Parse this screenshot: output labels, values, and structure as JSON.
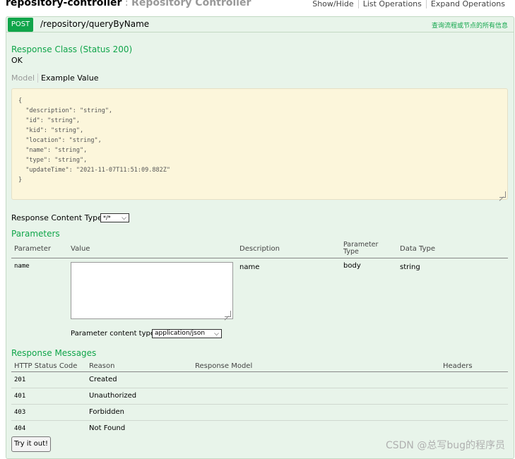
{
  "header": {
    "controller_name": "repository-controller",
    "separator": " : ",
    "controller_desc": "Repository Controller",
    "links": [
      "Show/Hide",
      "List Operations",
      "Expand Operations"
    ]
  },
  "operation": {
    "method": "POST",
    "path": "/repository/queryByName",
    "summary": "查询流程或节点的所有信息"
  },
  "response_class": {
    "title": "Response Class (Status 200)",
    "status": "OK",
    "tabs": {
      "model": "Model",
      "example": "Example Value"
    },
    "example_lines": [
      "{",
      "  \"description\": \"string\",",
      "  \"id\": \"string\",",
      "  \"kid\": \"string\",",
      "  \"location\": \"string\",",
      "  \"name\": \"string\",",
      "  \"type\": \"string\",",
      "  \"updateTime\": \"2021-11-07T11:51:09.882Z\"",
      "}"
    ]
  },
  "response_content_type": {
    "label": "Response Content Type",
    "selected": "*/*"
  },
  "parameters": {
    "title": "Parameters",
    "headers": {
      "parameter": "Parameter",
      "value": "Value",
      "description": "Description",
      "parameter_type_1": "Parameter",
      "parameter_type_2": "Type",
      "data_type": "Data Type"
    },
    "rows": [
      {
        "name": "name",
        "value": "",
        "description": "name",
        "parameter_type": "body",
        "data_type": "string"
      }
    ],
    "content_type_label": "Parameter content type:",
    "content_type_selected": "application/json"
  },
  "response_messages": {
    "title": "Response Messages",
    "headers": {
      "code": "HTTP Status Code",
      "reason": "Reason",
      "model": "Response Model",
      "headers": "Headers"
    },
    "rows": [
      {
        "code": "201",
        "reason": "Created"
      },
      {
        "code": "401",
        "reason": "Unauthorized"
      },
      {
        "code": "403",
        "reason": "Forbidden"
      },
      {
        "code": "404",
        "reason": "Not Found"
      }
    ]
  },
  "try_button": "Try it out!",
  "watermark": "CSDN @总写bug的程序员"
}
